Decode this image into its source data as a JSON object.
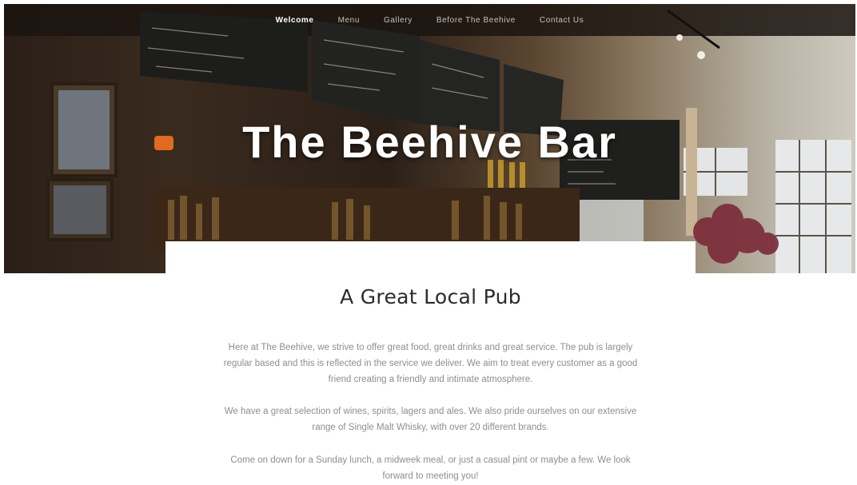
{
  "nav": {
    "items": [
      {
        "label": "Welcome",
        "active": true
      },
      {
        "label": "Menu",
        "active": false
      },
      {
        "label": "Gallery",
        "active": false
      },
      {
        "label": "Before The Beehive",
        "active": false
      },
      {
        "label": "Contact Us",
        "active": false
      }
    ]
  },
  "hero": {
    "title": "The Beehive Bar"
  },
  "content": {
    "heading": "A Great Local Pub",
    "paragraphs": [
      "Here at The Beehive, we strive to offer great food, great drinks and great service. The pub is largely regular based and this is reflected in the service we deliver. We aim to treat every customer as a good friend creating a friendly and intimate atmosphere.",
      "We have a great selection of wines, spirits, lagers and ales.  We also pride ourselves on our extensive range of Single Malt Whisky, with over 20 different brands.",
      "Come on down for a Sunday lunch, a midweek meal, or just a casual pint or maybe a few. We look forward to meeting you!"
    ]
  },
  "colors": {
    "heading": "#2b2b2b",
    "body_text": "#8e8e8e",
    "nav_text": "#ffffff"
  }
}
